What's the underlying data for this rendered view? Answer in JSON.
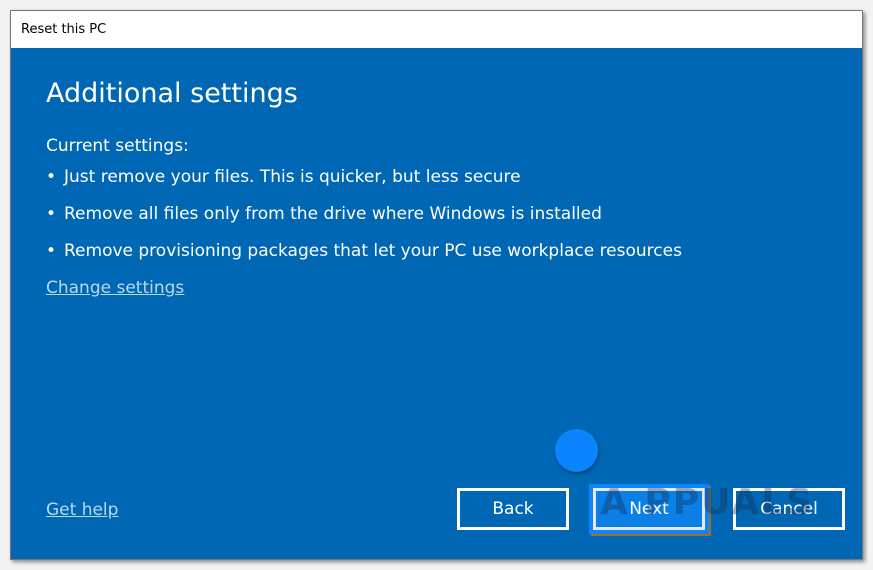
{
  "window": {
    "title": "Reset this PC"
  },
  "main": {
    "heading": "Additional settings",
    "current_label": "Current settings:",
    "bullet_char": "•",
    "settings": [
      "Just remove your files. This is quicker, but less secure",
      "Remove all files only from the drive where Windows is installed",
      "Remove provisioning packages that let your PC use workplace resources"
    ],
    "change_link": "Change settings"
  },
  "footer": {
    "help_link": "Get help",
    "back": "Back",
    "next": "Next",
    "cancel": "Cancel"
  },
  "watermark": "A PPUALS",
  "colors": {
    "background": "#0067b4",
    "highlight": "#0a84ff"
  }
}
